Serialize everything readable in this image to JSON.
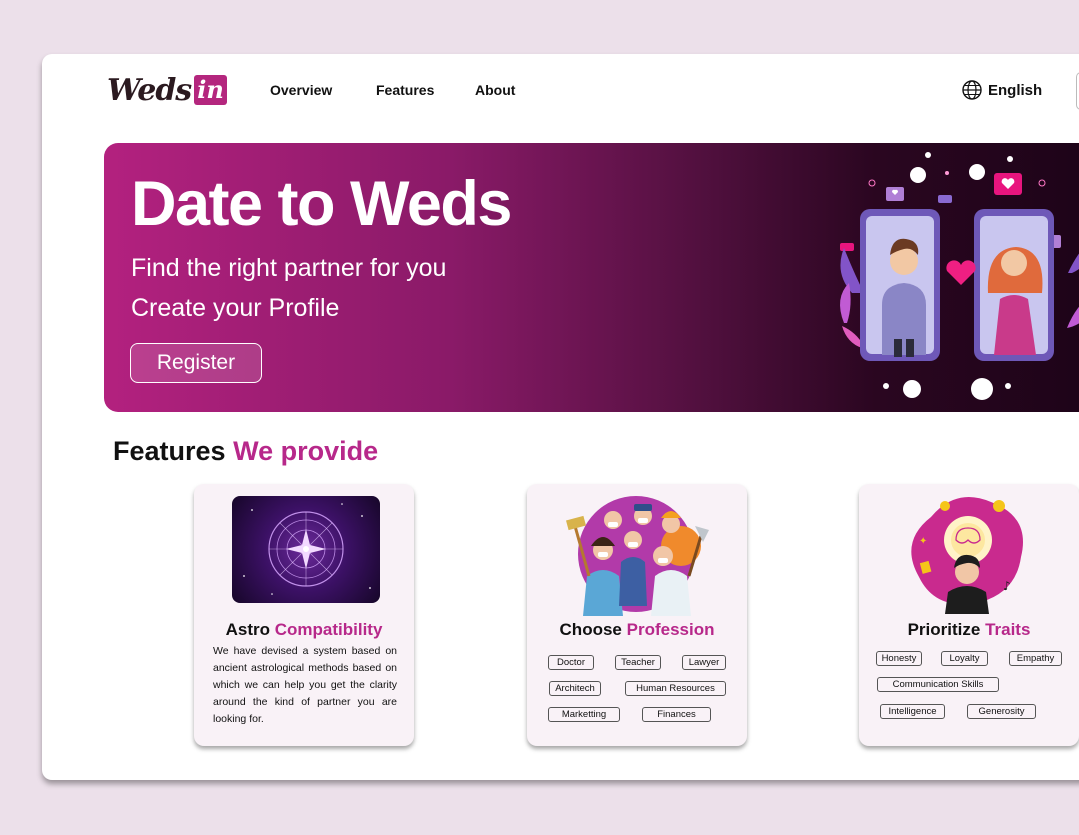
{
  "brand": {
    "logo_text": "Weds",
    "logo_badge": "in"
  },
  "nav": {
    "links": [
      "Overview",
      "Features",
      "About"
    ],
    "language": "English"
  },
  "hero": {
    "title": "Date to Weds",
    "subtitle_1": "Find the right partner for you",
    "subtitle_2": "Create your Profile",
    "register_label": "Register"
  },
  "features": {
    "heading_dark": "Features",
    "heading_pink": "We provide",
    "cards": [
      {
        "title_dark": "Astro",
        "title_pink": "Compatibility",
        "description": "We have devised a system based on ancient astrological methods based on which we can help you get the clarity around the kind of partner you are looking for."
      },
      {
        "title_dark": "Choose",
        "title_pink": "Profession",
        "tags": [
          "Doctor",
          "Teacher",
          "Lawyer",
          "Architech",
          "Human Resources",
          "Marketting",
          "Finances"
        ]
      },
      {
        "title_dark": "Prioritize",
        "title_pink": "Traits",
        "tags": [
          "Honesty",
          "Loyalty",
          "Empathy",
          "Communication Skills",
          "Intelligence",
          "Generosity"
        ]
      }
    ]
  },
  "colors": {
    "accent": "#b7288a",
    "background": "#ece0ea",
    "hero_start": "#b3217f",
    "hero_end": "#1d0418"
  }
}
